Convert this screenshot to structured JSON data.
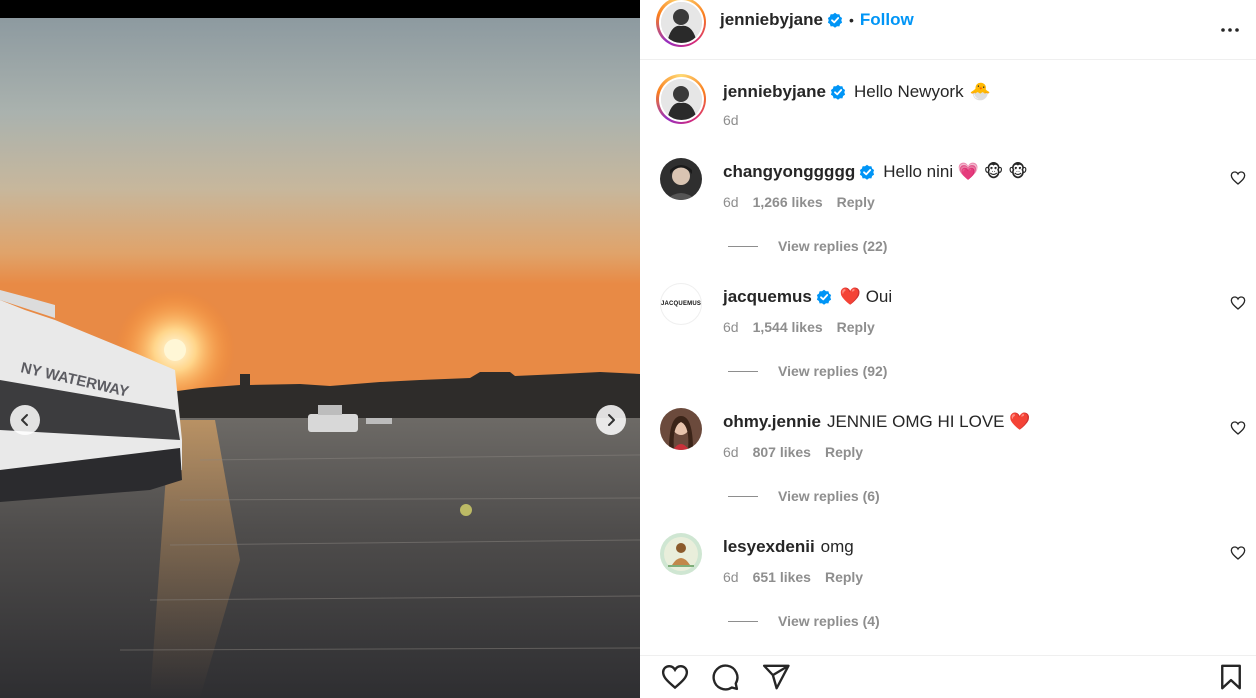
{
  "post": {
    "author": "jenniebyjane",
    "follow_label": "Follow",
    "dot": "•",
    "caption": "Hello Newyork",
    "caption_emoji": "🐣",
    "caption_time": "6d"
  },
  "photo": {
    "sign_text": "NY WATERWAY"
  },
  "comments": [
    {
      "username": "changyonggggg",
      "verified": true,
      "text": "Hello nini 💗 🐵 🐵",
      "time": "6d",
      "likes": "1,266 likes",
      "reply_label": "Reply",
      "view_replies": "View replies (22)"
    },
    {
      "username": "jacquemus",
      "verified": true,
      "text": "❤️  Oui",
      "time": "6d",
      "likes": "1,544 likes",
      "reply_label": "Reply",
      "view_replies": "View replies (92)",
      "avatar_text": "JACQUEMUS"
    },
    {
      "username": "ohmy.jennie",
      "verified": false,
      "text": "JENNIE OMG HI LOVE ❤️",
      "time": "6d",
      "likes": "807 likes",
      "reply_label": "Reply",
      "view_replies": "View replies (6)"
    },
    {
      "username": "lesyexdenii",
      "verified": false,
      "text": "omg",
      "time": "6d",
      "likes": "651 likes",
      "reply_label": "Reply",
      "view_replies": "View replies (4)"
    }
  ],
  "icons": {
    "more": "more-options-icon",
    "like": "heart-icon",
    "comment": "comment-icon",
    "share": "send-icon",
    "save": "bookmark-icon",
    "verified": "verified-badge-icon"
  },
  "colors": {
    "accent": "#0095f6",
    "verified": "#0095f6",
    "heart_red": "#ff3040",
    "muted": "#8e8e8e"
  }
}
